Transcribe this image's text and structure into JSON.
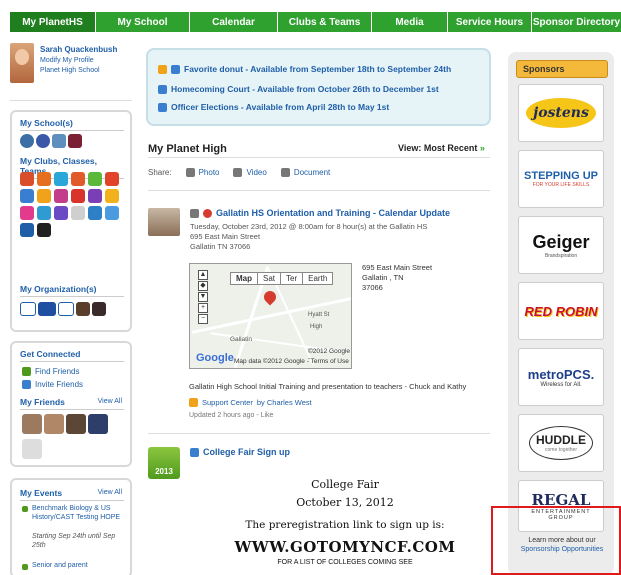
{
  "nav": {
    "tabs": [
      "My PlanetHS",
      "My School",
      "Calendar",
      "Clubs & Teams",
      "Media",
      "Service Hours",
      "Sponsor Directory"
    ],
    "active": 0
  },
  "profile": {
    "name": "Sarah Quackenbush",
    "modify": "Modify My Profile",
    "school": "Planet High School"
  },
  "left": {
    "my_schools": "My School(s)",
    "my_clubs": "My Clubs, Classes, Teams",
    "my_orgs": "My Organization(s)",
    "get_connected": "Get Connected",
    "find_friends": "Find Friends",
    "invite_friends": "Invite Friends",
    "my_friends": "My Friends",
    "view_all": "View All",
    "my_events": "My Events",
    "events_view_all": "View All",
    "event1_title": "Benchmark Biology & US History/CAST Testing HOPE",
    "event1_time": "Starting Sep 24th until Sep 25th",
    "event2_title": "Senior and parent"
  },
  "announcements": [
    "Favorite donut - Available from September 18th to September 24th",
    "Homecoming Court - Available from October 26th to December 1st",
    "Officer Elections - Available from April 28th to May 1st"
  ],
  "feed": {
    "header": "My Planet High",
    "view_most": "View: Most Recent",
    "share_label": "Share:",
    "share_photo": "Photo",
    "share_video": "Video",
    "share_document": "Document"
  },
  "post1": {
    "title": "Gallatin HS Orientation and Training - Calendar Update",
    "meta_line1": "Tuesday, October 23rd, 2012 @ 8:00am for 8 hour(s) at the Gallatin HS",
    "meta_line2": "695 East Main Street",
    "meta_line3": "Gallatin TN 37066",
    "map_tabs": [
      "Map",
      "Sat",
      "Ter",
      "Earth"
    ],
    "map_google": "Google",
    "map_data": "Map data ©2012 Google - Terms of Use",
    "map_label_hyatt": "Hyatt St",
    "map_label_high": "High",
    "map_label_gallatin": "Gallatin",
    "map_label_y": "y",
    "map_label_copy": "©2012 Google -",
    "address_line1": "695 East Main Street",
    "address_line2": "Gallatin , TN",
    "address_line3": "37066",
    "description": "Gallatin High School Initial Training and presentation to teachers - Chuck and Kathy",
    "support_prefix": "Support Center",
    "support_by": "by Charles West",
    "updated": "Updated 2 hours ago - Like"
  },
  "post2": {
    "thumb_text": "2013",
    "title": "College Fair Sign up",
    "flyer_l1": "College Fair",
    "flyer_l2": "October 13, 2012",
    "flyer_l3": "The preregistration link to sign up is:",
    "flyer_l4": "WWW.GOTOMYNCF.COM",
    "flyer_l5": "FOR A LIST OF COLLEGES COMING SEE"
  },
  "sponsors": {
    "header": "Sponsors",
    "items": [
      {
        "name": "jostens"
      },
      {
        "name": "STEPPING UP",
        "tag": "FOR YOUR LIFE SKILLS"
      },
      {
        "name": "Geiger",
        "tag": "Brandspiration"
      },
      {
        "name": "RED ROBIN"
      },
      {
        "name": "metroPCS.",
        "tag": "Wireless for All."
      },
      {
        "name": "HUDDLE",
        "tag": "come together"
      },
      {
        "name": "REGAL",
        "tag": "ENTERTAINMENT GROUP"
      }
    ],
    "learn_line1": "Learn more about our",
    "learn_line2": "Sponsorship Opportunities"
  },
  "colors": {
    "nav_green": "#2fa12f",
    "link_blue": "#1f5fa8",
    "sponsor_orange": "#f4b93b",
    "highlight_red": "#e01a1a"
  }
}
